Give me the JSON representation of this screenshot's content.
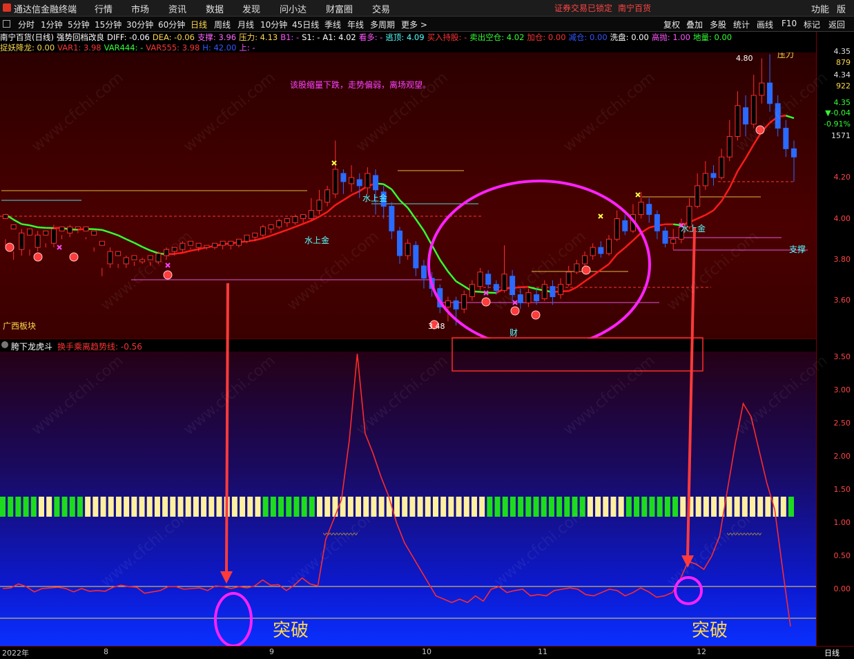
{
  "app": {
    "title": "通达信金融终端",
    "notice": "证券交易已锁定",
    "stock_name": "南宁百货",
    "right_menu": [
      "功能",
      "版面"
    ]
  },
  "menu": [
    "行情",
    "市场",
    "资讯",
    "数据",
    "发现",
    "问小达",
    "财富圈",
    "交易"
  ],
  "periods": [
    "分时",
    "1分钟",
    "5分钟",
    "15分钟",
    "30分钟",
    "60分钟",
    "日线",
    "周线",
    "月线",
    "10分钟",
    "45日线",
    "季线",
    "年线",
    "多周期",
    "更多 >"
  ],
  "active_period": "日线",
  "toolbar_right": [
    "复权",
    "叠加",
    "多股",
    "统计",
    "画线",
    "F10",
    "标记",
    "返回"
  ],
  "info_line1": [
    {
      "text": "南宁百货(日线)",
      "color": "#ffffff"
    },
    {
      "text": "强势回档改良",
      "color": "#ffffff"
    },
    {
      "text": "DIFF: -0.06",
      "color": "#ffffff"
    },
    {
      "text": "DEA: -0.06",
      "color": "#ffd84d"
    },
    {
      "text": "支撑: 3.96",
      "color": "#ff66ff"
    },
    {
      "text": "压力: 4.13",
      "color": "#ffd84d"
    },
    {
      "text": "B1: -",
      "color": "#ff55ff"
    },
    {
      "text": "S1: -",
      "color": "#ffffff"
    },
    {
      "text": "A1: 4.02",
      "color": "#ffffff"
    },
    {
      "text": "看多: -",
      "color": "#ff55ff"
    },
    {
      "text": "逃顶: 4.09",
      "color": "#55ffff"
    },
    {
      "text": "买入持股: -",
      "color": "#ff3333"
    },
    {
      "text": "卖出空仓: 4.02",
      "color": "#33ff33"
    },
    {
      "text": "加仓: 0.00",
      "color": "#ff3333"
    },
    {
      "text": "减仓: 0.00",
      "color": "#3355ff"
    },
    {
      "text": "洗盘: 0.00",
      "color": "#ffffff"
    },
    {
      "text": "高抛: 1.00",
      "color": "#ff55ff"
    },
    {
      "text": "地量: 0.00",
      "color": "#33ff33"
    }
  ],
  "info_line2": [
    {
      "text": "捉妖降龙: 0.00",
      "color": "#ffd84d"
    },
    {
      "text": "VAR1: 3.98",
      "color": "#ff3333"
    },
    {
      "text": "VAR444: -",
      "color": "#33ff33"
    },
    {
      "text": "VAR555: 3.98",
      "color": "#ff3333"
    },
    {
      "text": "H: 42.00",
      "color": "#3355ff"
    },
    {
      "text": "上: -",
      "color": "#ff55ff"
    }
  ],
  "main": {
    "commentary": "该股缩量下跌，走势偏弱，离场观望。",
    "sector": "广西板块",
    "high_marker": "4.80",
    "low_marker": "3.48",
    "pressure_label": "压力",
    "support_label": "支撑",
    "water_gold_label": "水上金",
    "cai_label": "财"
  },
  "indicator": {
    "name": "胯下龙虎斗",
    "line_label": "换手乘离趋势线: -0.56",
    "breakthrough_label": "突破"
  },
  "price_axis": [
    "4.35",
    "879",
    "4.34",
    "922",
    "4.35",
    "▼-0.04",
    "-0.91%",
    "1571",
    "4.20",
    "4.00",
    "3.80",
    "3.60"
  ],
  "ind_axis": [
    "3.50",
    "3.00",
    "2.50",
    "2.00",
    "1.50",
    "1.00",
    "0.50",
    "0.00"
  ],
  "dates": [
    "2022年",
    "8",
    "9",
    "10",
    "11",
    "12"
  ],
  "bottom_right": "日线",
  "watermark": "www.cfchi.com",
  "colors": {
    "up": "#ff2d2d",
    "down": "#2a6bff",
    "ma_up": "#ff1a1a",
    "ma_down": "#33ff33",
    "highlight": "#ff22ff"
  },
  "candles": [
    [
      4.0,
      4.02,
      3.9,
      3.86
    ],
    [
      3.95,
      3.97,
      3.84,
      3.8
    ],
    [
      3.85,
      3.93,
      3.95,
      3.82
    ],
    [
      3.92,
      3.95,
      3.85,
      3.82
    ],
    [
      3.86,
      3.92,
      3.94,
      3.84
    ],
    [
      3.92,
      3.94,
      3.88,
      3.86
    ],
    [
      3.88,
      3.95,
      3.97,
      3.86
    ],
    [
      3.94,
      3.96,
      3.92,
      3.9
    ],
    [
      3.93,
      3.96,
      3.97,
      3.91
    ],
    [
      3.95,
      3.96,
      3.94,
      3.93
    ],
    [
      3.94,
      3.96,
      3.91,
      3.9
    ],
    [
      3.92,
      3.94,
      3.86,
      3.84
    ],
    [
      3.87,
      3.89,
      3.76,
      3.72
    ],
    [
      3.78,
      3.84,
      3.86,
      3.76
    ],
    [
      3.82,
      3.84,
      3.78,
      3.76
    ],
    [
      3.78,
      3.81,
      3.82,
      3.76
    ],
    [
      3.8,
      3.82,
      3.79,
      3.77
    ],
    [
      3.79,
      3.8,
      3.81,
      3.78
    ],
    [
      3.8,
      3.82,
      3.79,
      3.77
    ],
    [
      3.79,
      3.83,
      3.84,
      3.78
    ],
    [
      3.82,
      3.85,
      3.86,
      3.8
    ],
    [
      3.84,
      3.86,
      3.85,
      3.82
    ],
    [
      3.85,
      3.88,
      3.89,
      3.83
    ],
    [
      3.87,
      3.89,
      3.86,
      3.85
    ],
    [
      3.86,
      3.88,
      3.87,
      3.84
    ],
    [
      3.86,
      3.87,
      3.86,
      3.85
    ],
    [
      3.86,
      3.88,
      3.88,
      3.85
    ],
    [
      3.87,
      3.89,
      3.87,
      3.85
    ],
    [
      3.87,
      3.89,
      3.87,
      3.85
    ],
    [
      3.87,
      3.9,
      3.9,
      3.86
    ],
    [
      3.89,
      3.92,
      3.92,
      3.88
    ],
    [
      3.91,
      3.93,
      3.91,
      3.89
    ],
    [
      3.92,
      3.96,
      3.97,
      3.91
    ],
    [
      3.95,
      3.97,
      3.96,
      3.93
    ],
    [
      3.96,
      3.99,
      4.0,
      3.95
    ],
    [
      3.98,
      4.0,
      3.98,
      3.96
    ],
    [
      3.98,
      4.01,
      4.02,
      3.97
    ],
    [
      4.0,
      4.02,
      4.0,
      3.98
    ],
    [
      4.0,
      4.04,
      4.1,
      3.99
    ],
    [
      4.04,
      4.09,
      4.14,
      4.02
    ],
    [
      4.08,
      4.14,
      4.16,
      4.06
    ],
    [
      4.12,
      4.24,
      4.38,
      4.1
    ],
    [
      4.22,
      4.18,
      4.24,
      4.12
    ],
    [
      4.17,
      4.2,
      4.26,
      4.13
    ],
    [
      4.19,
      4.16,
      4.22,
      4.1
    ],
    [
      4.15,
      4.22,
      4.25,
      4.12
    ],
    [
      4.21,
      4.14,
      4.24,
      4.02
    ],
    [
      4.13,
      4.06,
      4.16,
      4.0
    ],
    [
      4.06,
      3.94,
      4.08,
      3.9
    ],
    [
      3.94,
      3.82,
      3.96,
      3.78
    ],
    [
      3.82,
      3.88,
      3.9,
      3.8
    ],
    [
      3.87,
      3.76,
      3.89,
      3.72
    ],
    [
      3.77,
      3.71,
      3.8,
      3.66
    ],
    [
      3.71,
      3.66,
      3.74,
      3.62
    ],
    [
      3.66,
      3.57,
      3.68,
      3.54
    ],
    [
      3.57,
      3.6,
      3.62,
      3.5
    ],
    [
      3.6,
      3.56,
      3.62,
      3.48
    ],
    [
      3.56,
      3.63,
      3.65,
      3.54
    ],
    [
      3.62,
      3.68,
      3.7,
      3.6
    ],
    [
      3.67,
      3.74,
      3.76,
      3.65
    ],
    [
      3.73,
      3.68,
      3.75,
      3.66
    ],
    [
      3.68,
      3.65,
      3.7,
      3.63
    ],
    [
      3.65,
      3.73,
      3.87,
      3.64
    ],
    [
      3.72,
      3.63,
      3.75,
      3.6
    ],
    [
      3.63,
      3.59,
      3.66,
      3.56
    ],
    [
      3.59,
      3.64,
      3.66,
      3.57
    ],
    [
      3.63,
      3.6,
      3.66,
      3.58
    ],
    [
      3.61,
      3.68,
      3.7,
      3.6
    ],
    [
      3.67,
      3.62,
      3.7,
      3.58
    ],
    [
      3.63,
      3.68,
      3.71,
      3.61
    ],
    [
      3.68,
      3.74,
      3.77,
      3.67
    ],
    [
      3.74,
      3.78,
      3.8,
      3.73
    ],
    [
      3.78,
      3.82,
      3.84,
      3.76
    ],
    [
      3.82,
      3.86,
      3.88,
      3.8
    ],
    [
      3.86,
      3.83,
      3.89,
      3.81
    ],
    [
      3.83,
      3.9,
      3.92,
      3.82
    ],
    [
      3.9,
      4.0,
      4.04,
      3.89
    ],
    [
      3.99,
      3.94,
      4.02,
      3.92
    ],
    [
      3.94,
      4.02,
      4.07,
      3.93
    ],
    [
      4.02,
      4.08,
      4.13,
      4.0
    ],
    [
      4.07,
      4.02,
      4.1,
      3.98
    ],
    [
      4.02,
      3.94,
      4.04,
      3.9
    ],
    [
      3.94,
      3.88,
      3.96,
      3.86
    ],
    [
      3.88,
      3.9,
      3.95,
      3.85
    ],
    [
      3.9,
      3.96,
      4.0,
      3.88
    ],
    [
      3.96,
      4.06,
      4.1,
      3.95
    ],
    [
      4.06,
      4.16,
      4.22,
      4.05
    ],
    [
      4.16,
      4.22,
      4.28,
      4.14
    ],
    [
      4.22,
      4.2,
      4.26,
      4.16
    ],
    [
      4.2,
      4.3,
      4.34,
      4.19
    ],
    [
      4.3,
      4.4,
      4.48,
      4.28
    ],
    [
      4.4,
      4.55,
      4.62,
      4.38
    ],
    [
      4.54,
      4.46,
      4.6,
      4.4
    ],
    [
      4.46,
      4.6,
      4.7,
      4.44
    ],
    [
      4.6,
      4.66,
      4.78,
      4.56
    ],
    [
      4.66,
      4.56,
      4.8,
      4.52
    ],
    [
      4.56,
      4.44,
      4.6,
      4.4
    ],
    [
      4.44,
      4.34,
      4.48,
      4.3
    ],
    [
      4.34,
      4.3,
      4.38,
      4.18
    ]
  ],
  "indicator_line": [
    0.01,
    0.02,
    0.08,
    0.04,
    -0.04,
    0.01,
    0.02,
    0.03,
    0.01,
    -0.04,
    0.01,
    -0.03,
    -0.02,
    -0.03,
    0.03,
    0.06,
    0.04,
    0.03,
    -0.06,
    -0.04,
    -0.02,
    0.04,
    0.04,
    0.0,
    0.01,
    0.02,
    -0.02,
    0.05,
    0.04,
    0.01,
    0.04,
    0.02,
    0.05,
    0.14,
    0.06,
    0.07,
    -0.02,
    0.06,
    0.17,
    0.08,
    0.05,
    0.75,
    1.05,
    1.35,
    2.25,
    3.55,
    2.35,
    2.05,
    1.7,
    1.4,
    1.0,
    0.7,
    0.5,
    0.3,
    0.1,
    -0.1,
    -0.15,
    -0.2,
    -0.15,
    -0.2,
    -0.1,
    -0.18,
    0.0,
    0.04,
    -0.05,
    -0.02,
    0.0,
    -0.1,
    -0.08,
    -0.1,
    -0.02,
    0.0,
    0.02,
    0.0,
    -0.08,
    -0.1,
    -0.05,
    0.0,
    -0.02,
    -0.1,
    -0.05,
    0.02,
    -0.04,
    -0.12,
    -0.1,
    -0.05,
    0.15,
    0.42,
    0.38,
    0.3,
    0.5,
    0.8,
    1.5,
    2.2,
    2.8,
    2.6,
    2.1,
    1.6,
    1.2,
    0.3,
    -0.56
  ],
  "ind_bars": [
    0,
    0,
    0,
    0,
    0,
    1,
    1,
    0,
    0,
    0,
    0,
    1,
    1,
    1,
    1,
    1,
    1,
    1,
    1,
    1,
    1,
    1,
    1,
    1,
    1,
    1,
    1,
    1,
    1,
    1,
    1,
    1,
    1,
    1,
    0,
    0,
    0,
    0,
    0,
    0,
    0,
    1,
    1,
    1,
    1,
    1,
    1,
    1,
    1,
    1,
    1,
    1,
    1,
    1,
    1,
    1,
    1,
    1,
    1,
    1,
    1,
    1,
    1,
    0,
    0,
    0,
    0,
    0,
    0,
    0,
    0,
    0,
    0,
    0,
    0,
    0,
    1,
    1,
    1,
    1,
    1,
    0,
    0,
    0,
    0,
    0,
    0,
    0,
    1,
    1,
    1,
    1,
    1,
    1,
    1,
    1,
    1,
    1,
    1,
    1,
    1,
    1,
    0
  ]
}
